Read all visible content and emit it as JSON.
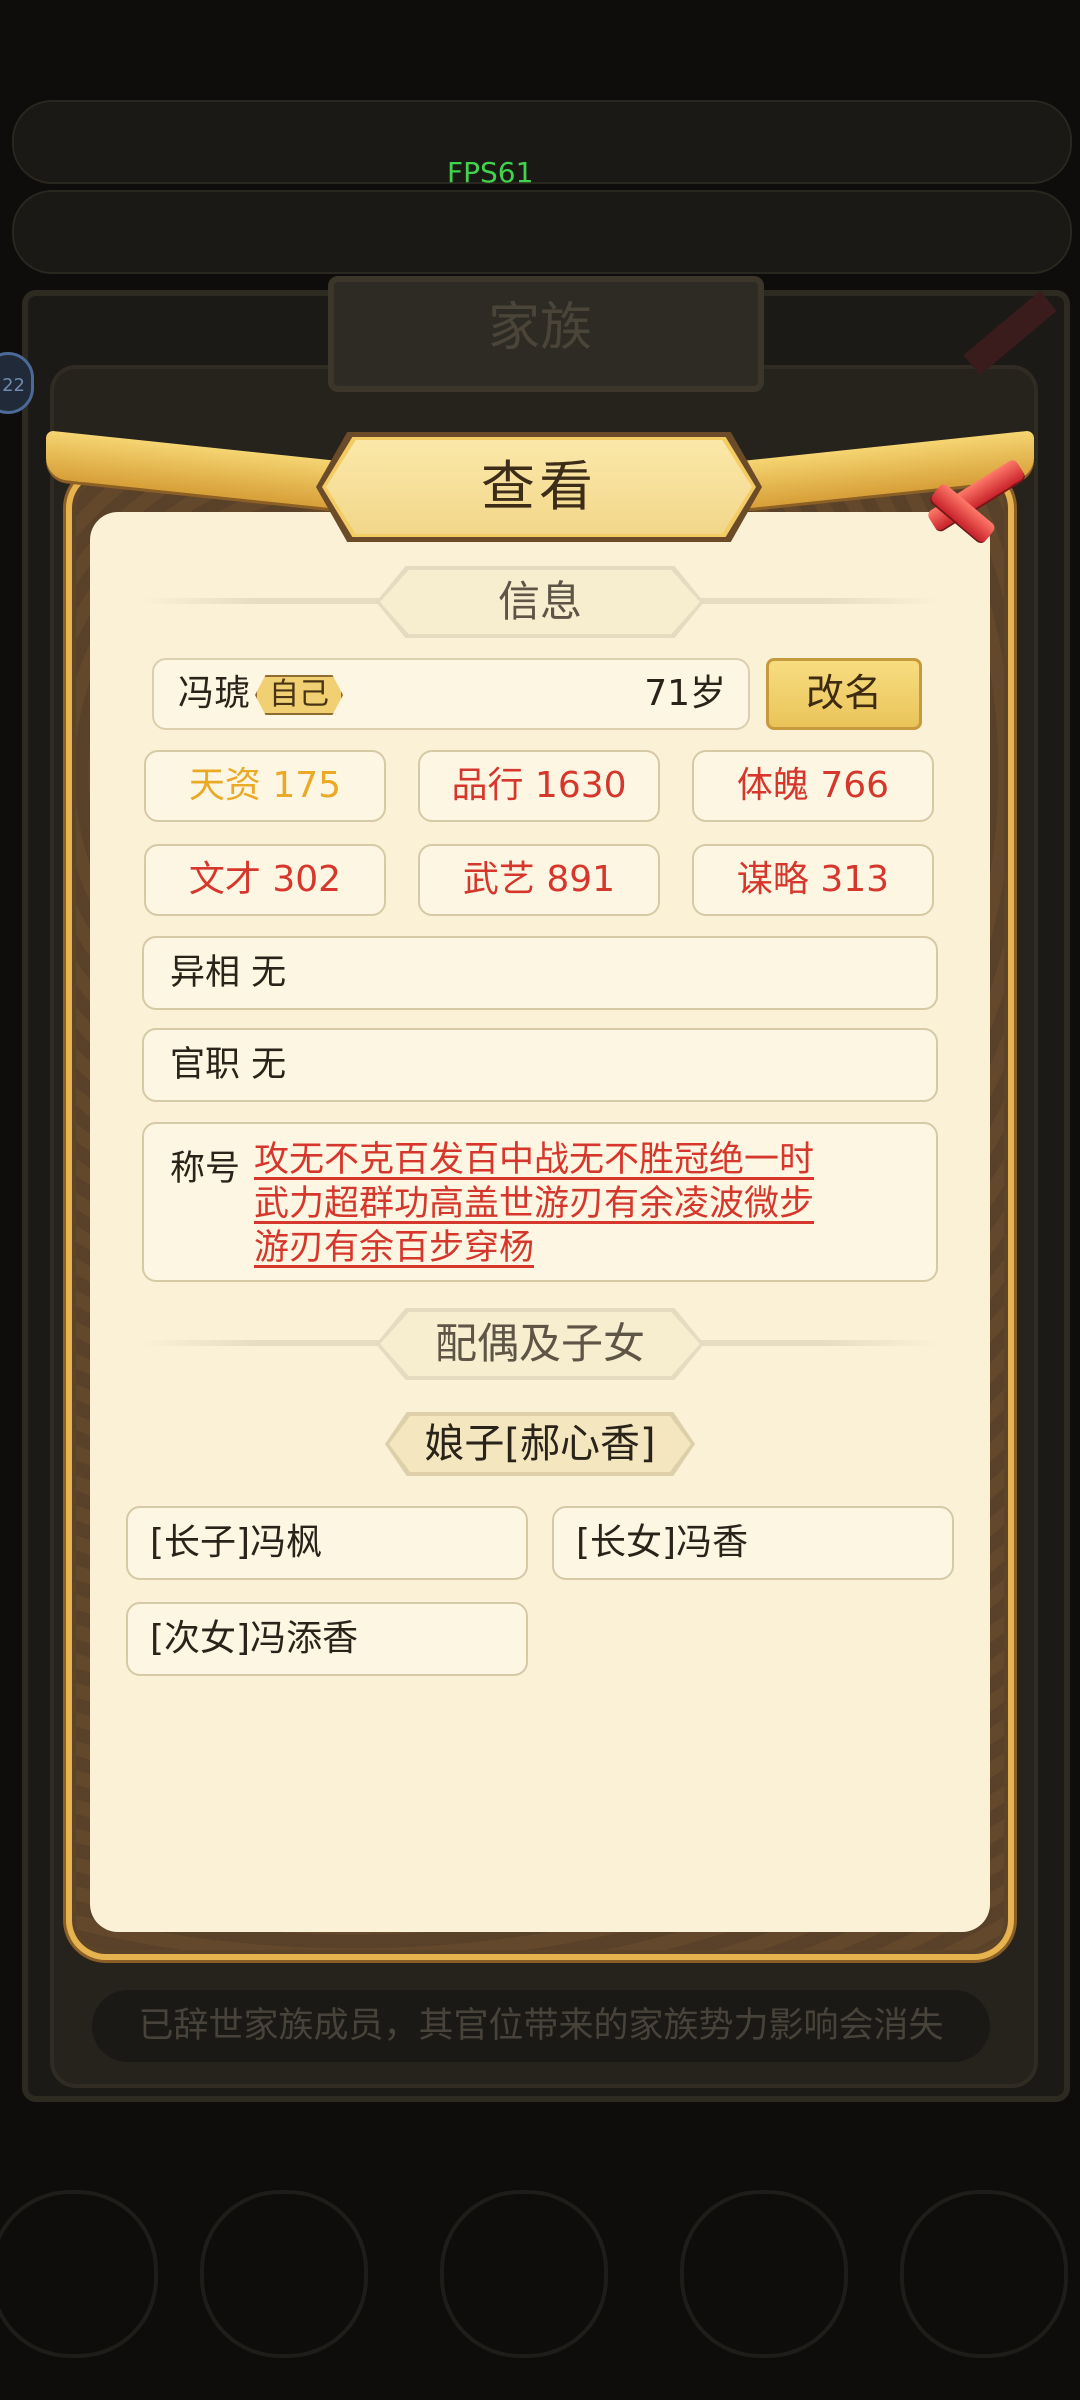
{
  "fps_label": "FPS61",
  "background": {
    "family_header": "家族",
    "notice": "已辞世家族成员，其官位带来的家族势力影响会消失",
    "badge": "22"
  },
  "dialog": {
    "title": "查看",
    "info_header": "信息",
    "member": {
      "name": "冯琥",
      "self_tag": "自己",
      "age": "71岁",
      "rename_label": "改名"
    },
    "stats": [
      {
        "label": "天资 175",
        "highlight": true
      },
      {
        "label": "品行 1630",
        "highlight": false
      },
      {
        "label": "体魄 766",
        "highlight": false
      },
      {
        "label": "文才 302",
        "highlight": false
      },
      {
        "label": "武艺 891",
        "highlight": false
      },
      {
        "label": "谋略 313",
        "highlight": false
      }
    ],
    "appearance": "异相 无",
    "office": "官职 无",
    "titles_label": "称号",
    "titles_lines": [
      "攻无不克百发百中战无不胜冠绝一时",
      "武力超群功高盖世游刃有余凌波微步",
      "游刃有余百步穿杨"
    ],
    "spouse_header": "配偶及子女",
    "spouse": "娘子[郝心香]",
    "children": [
      "[长子]冯枫",
      "[长女]冯香",
      "[次女]冯添香"
    ]
  },
  "colors": {
    "accent_red": "#d6372c",
    "accent_gold": "#eaa926",
    "panel": "#faf1d7"
  }
}
